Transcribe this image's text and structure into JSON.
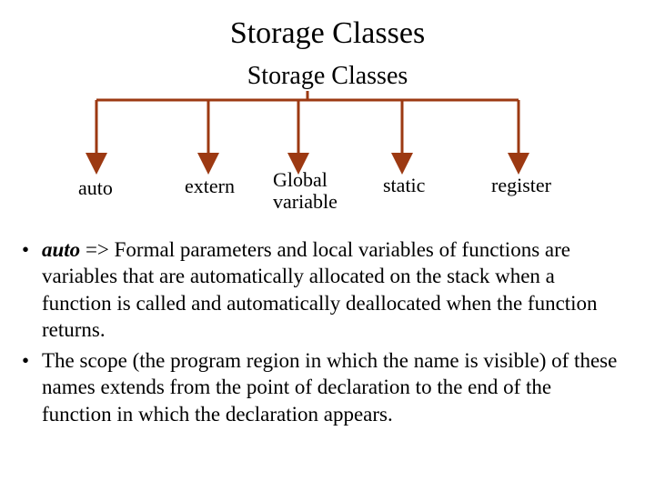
{
  "title": "Storage Classes",
  "subtitle": "Storage Classes",
  "tree": {
    "line_color": "#9c3912",
    "leaves": [
      "auto",
      "extern",
      "Global\nvariable",
      "static",
      "register"
    ]
  },
  "bullets": [
    {
      "keyword": "auto",
      "sep": " => ",
      "rest": "Formal parameters and local variables of functions are variables that are automatically allocated on the stack when a function is called and automatically deallocated when the function returns."
    },
    {
      "keyword": "",
      "sep": "",
      "rest": "The scope (the program region in which the name is visible) of these names extends from the point of declaration to the end of the function in which the declaration appears."
    }
  ]
}
